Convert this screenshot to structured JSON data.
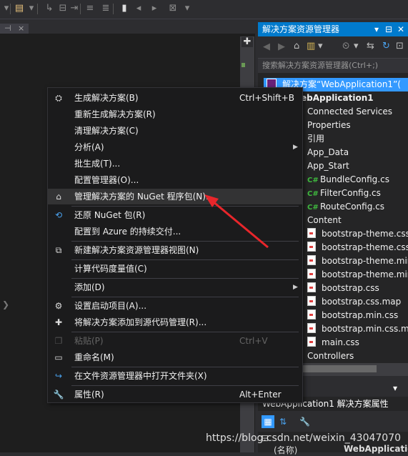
{
  "left_panel": {
    "tab_pin": "⊣",
    "tab_close": "×",
    "split_icon": "✚",
    "chevron": "❯"
  },
  "solution_explorer": {
    "title": "解决方案资源管理器",
    "title_controls": [
      "▾",
      "⊟",
      "✕"
    ],
    "search_placeholder": "搜索解决方案资源管理器(Ctrl+;)",
    "tree": [
      {
        "text": "解决方案“WebApplication1”(",
        "kind": "solution",
        "selected": true
      },
      {
        "text": "ebApplication1",
        "kind": "project"
      },
      {
        "text": "Connected Services",
        "kind": "folder"
      },
      {
        "text": "Properties",
        "kind": "folder"
      },
      {
        "text": "引用",
        "kind": "folder"
      },
      {
        "text": "App_Data",
        "kind": "folder"
      },
      {
        "text": "App_Start",
        "kind": "folder"
      },
      {
        "text": "BundleConfig.cs",
        "kind": "cs"
      },
      {
        "text": "FilterConfig.cs",
        "kind": "cs"
      },
      {
        "text": "RouteConfig.cs",
        "kind": "cs"
      },
      {
        "text": "Content",
        "kind": "folder"
      },
      {
        "text": "bootstrap-theme.css",
        "kind": "file"
      },
      {
        "text": "bootstrap-theme.css.",
        "kind": "file"
      },
      {
        "text": "bootstrap-theme.min",
        "kind": "file"
      },
      {
        "text": "bootstrap-theme.min",
        "kind": "file"
      },
      {
        "text": "bootstrap.css",
        "kind": "file"
      },
      {
        "text": "bootstrap.css.map",
        "kind": "file"
      },
      {
        "text": "bootstrap.min.css",
        "kind": "file"
      },
      {
        "text": "bootstrap.min.css.map",
        "kind": "file"
      },
      {
        "text": "main.css",
        "kind": "file"
      },
      {
        "text": "Controllers",
        "kind": "folder"
      }
    ],
    "cs_badge": "C#"
  },
  "properties": {
    "title_partial": "",
    "subject": "WebApplication1 解决方案属性",
    "grid_label": "(名称)",
    "grid_value": "WebApplicatio"
  },
  "context_menu": {
    "items": [
      {
        "icon": "build-icon",
        "glyph": "⛭",
        "label": "生成解决方案(B)",
        "shortcut": "Ctrl+Shift+B"
      },
      {
        "icon": "",
        "glyph": "",
        "label": "重新生成解决方案(R)",
        "shortcut": ""
      },
      {
        "icon": "",
        "glyph": "",
        "label": "清理解决方案(C)",
        "shortcut": ""
      },
      {
        "icon": "",
        "glyph": "",
        "label": "分析(A)",
        "shortcut": "",
        "submenu": true
      },
      {
        "icon": "",
        "glyph": "",
        "label": "批生成(T)...",
        "shortcut": ""
      },
      {
        "icon": "",
        "glyph": "",
        "label": "配置管理器(O)...",
        "shortcut": ""
      },
      {
        "icon": "nuget-icon",
        "glyph": "⌂",
        "label": "管理解决方案的 NuGet 程序包(N)...",
        "shortcut": "",
        "highlight": true
      },
      {
        "icon": "restore-icon",
        "glyph": "⟲",
        "label": "还原 NuGet 包(R)",
        "shortcut": ""
      },
      {
        "icon": "",
        "glyph": "",
        "label": "配置到 Azure 的持续交付...",
        "shortcut": ""
      },
      {
        "icon": "new-view-icon",
        "glyph": "⧉",
        "label": "新建解决方案资源管理器视图(N)",
        "shortcut": ""
      },
      {
        "icon": "",
        "glyph": "",
        "label": "计算代码度量值(C)",
        "shortcut": ""
      },
      {
        "icon": "",
        "glyph": "",
        "label": "添加(D)",
        "shortcut": "",
        "submenu": true
      },
      {
        "icon": "gear-icon",
        "glyph": "⚙",
        "label": "设置启动项目(A)...",
        "shortcut": ""
      },
      {
        "icon": "add-source-icon",
        "glyph": "✚",
        "label": "将解决方案添加到源代码管理(R)...",
        "shortcut": ""
      },
      {
        "icon": "paste-icon",
        "glyph": "❐",
        "label": "粘贴(P)",
        "shortcut": "Ctrl+V",
        "disabled": true
      },
      {
        "icon": "rename-icon",
        "glyph": "▭",
        "label": "重命名(M)",
        "shortcut": ""
      },
      {
        "icon": "open-folder-icon",
        "glyph": "↪",
        "label": "在文件资源管理器中打开文件夹(X)",
        "shortcut": ""
      },
      {
        "icon": "wrench-icon",
        "glyph": "🔧",
        "label": "属性(R)",
        "shortcut": "Alt+Enter"
      }
    ]
  },
  "watermark": "https://blog.csdn.net/weixin_43047070",
  "colors": {
    "accent": "#007acc",
    "selection": "#3399ff",
    "arrow": "#e8262b",
    "menu_bg": "#1b1b1c"
  }
}
